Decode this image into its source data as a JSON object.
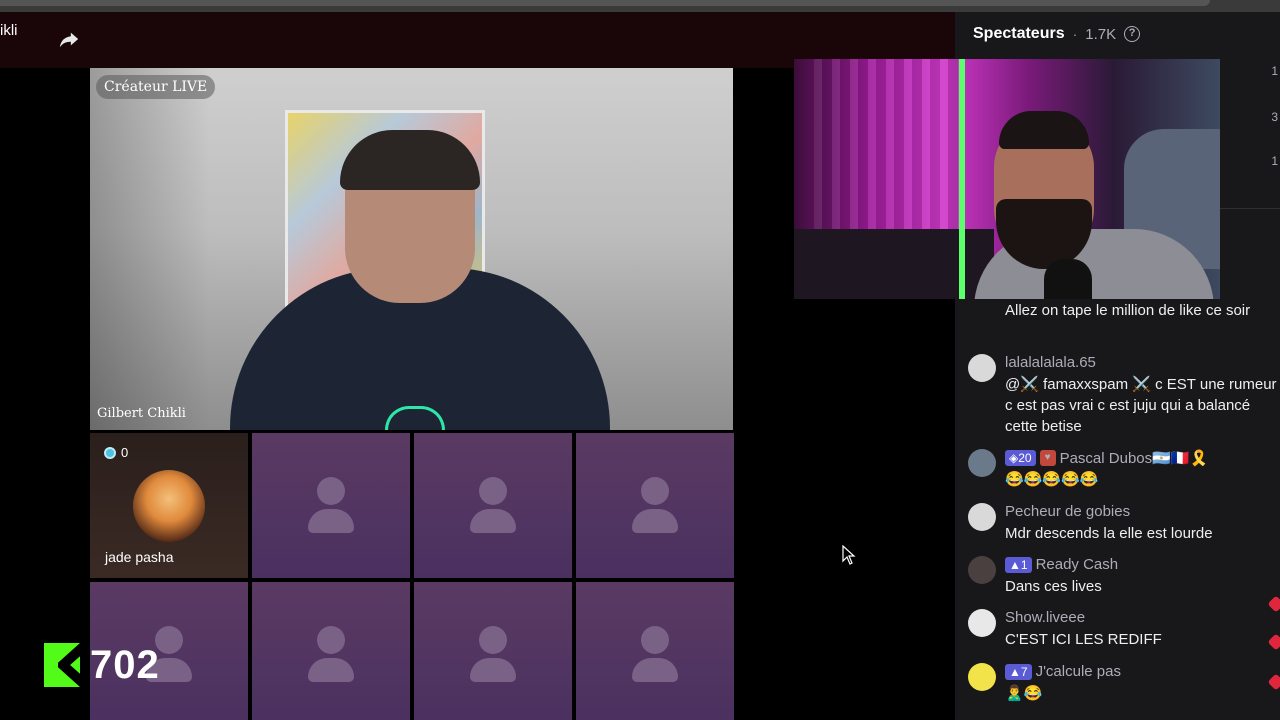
{
  "header": {
    "streamer_name": "ikli",
    "share_icon": "share-arrow-icon"
  },
  "main_video": {
    "live_badge": "Créateur LIVE",
    "host_name": "Gilbert Chikli"
  },
  "guest_tiles": [
    {
      "name": "jade pasha",
      "gift_count": "0"
    }
  ],
  "kick": {
    "logo": "K",
    "viewer_count": "702"
  },
  "chat_panel": {
    "title": "Spectateurs",
    "separator": "·",
    "viewer_count": "1.7K",
    "help_icon": "?",
    "side_digits": [
      "1",
      "3",
      "1"
    ],
    "messages": [
      {
        "user": "",
        "text": "Allez on tape le million de like ce soir"
      },
      {
        "user": "lalalalalala.65",
        "text": "@⚔️ famaxxspam ⚔️ c EST une rumeur c est pas vrai c est juju qui a balancé cette betise"
      },
      {
        "user": "Pascal Dubos🇦🇷🇫🇷🎗️",
        "badge": "◈20",
        "text": "😂😂😂😂😂"
      },
      {
        "user": "Pecheur de gobies",
        "text": "Mdr descends la elle est lourde"
      },
      {
        "user": "Ready Cash",
        "badge": "▲1",
        "text": "Dans ces lives"
      },
      {
        "user": "Show.liveee",
        "text": "C'EST ICI LES REDIFF"
      },
      {
        "user": "J'calcule pas",
        "badge": "▲7",
        "text": "🙎‍♂️😂"
      }
    ]
  },
  "colors": {
    "kick_green": "#53fc18",
    "panel_bg": "#18181b",
    "tile_purple": "#5a3a62"
  }
}
